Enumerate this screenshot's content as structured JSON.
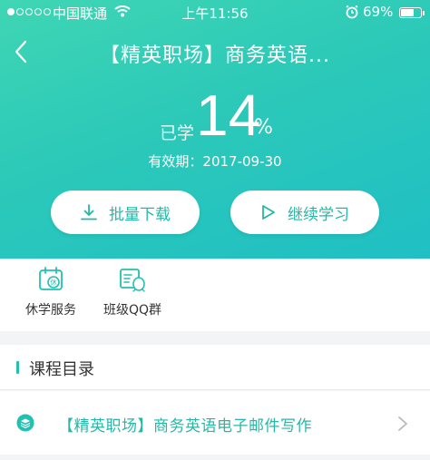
{
  "status_bar": {
    "carrier": "中国联通",
    "time": "上午11:56",
    "battery_percent": "69%",
    "battery_level": 0.69
  },
  "nav": {
    "title": "【精英职场】商务英语...",
    "back_icon": "chevron-left-icon"
  },
  "progress": {
    "label": "已学",
    "value": "14",
    "unit": "%",
    "validity": "有效期：2017-09-30"
  },
  "actions": {
    "download": {
      "label": "批量下载",
      "icon": "download-icon"
    },
    "continue": {
      "label": "继续学习",
      "icon": "play-icon"
    }
  },
  "services": [
    {
      "label": "休学服务",
      "icon": "calendar-rest-icon"
    },
    {
      "label": "班级QQ群",
      "icon": "qq-group-icon"
    }
  ],
  "catalog": {
    "heading": "课程目录",
    "items": [
      {
        "title": "【精英职场】商务英语电子邮件写作",
        "icon": "layers-icon"
      }
    ]
  },
  "colors": {
    "accent": "#21c1b0",
    "header_gradient_start": "#3fd6b4",
    "header_gradient_end": "#1fbfc4"
  }
}
